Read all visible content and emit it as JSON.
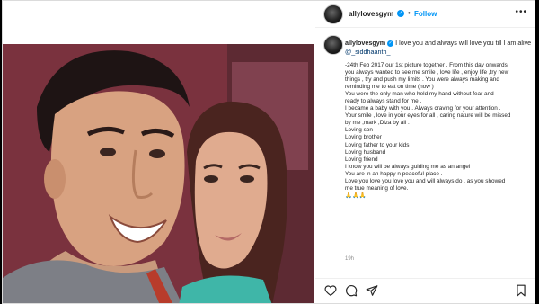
{
  "header": {
    "username": "allylovesgym",
    "verified_glyph": "✓",
    "separator": "•",
    "follow_label": "Follow",
    "more_glyph": "•••"
  },
  "caption": {
    "username": "allylovesgym",
    "lead_text": " I love you and always will love you till I am alive ",
    "mention": "@_siddhaanth_",
    "mention_suffix": " .",
    "lines": [
      "-24th Feb 2017 our 1st picture together . From this day onwards",
      "you always wanted to see me smile , love life , enjoy life ,try new",
      "things , try and push my limits . You were always making and",
      "reminding me to eat on time (now )",
      "You were the only man who held my hand without fear and",
      "ready to always stand for me .",
      "I became a baby with you . Always craving for your attention .",
      "Your smile , love in your eyes for all , caring nature will be missed",
      "by me ,mark ,Diza by all .",
      "Loving son",
      "Loving brother",
      "Loving father to your kids",
      "Loving husband",
      "Loving friend",
      "I know you will be always guiding me as an angel",
      "You are in an happy n peaceful place .",
      "Love you love you love you and will always do , as you showed",
      "me true meaning of love.",
      "🙏🙏🙏"
    ],
    "timestamp": "19h"
  },
  "icons": {
    "like": "heart-icon",
    "comment": "comment-icon",
    "share": "share-icon",
    "save": "bookmark-icon"
  },
  "colors": {
    "accent": "#0095f6",
    "mention": "#00376b",
    "background": "#000000"
  }
}
